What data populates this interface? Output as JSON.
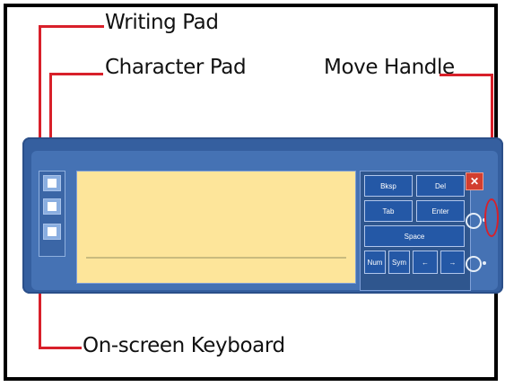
{
  "labels": {
    "writing_pad": "Writing Pad",
    "character_pad": "Character Pad",
    "move_handle": "Move Handle",
    "on_screen_keyboard": "On-screen Keyboard"
  },
  "keys": {
    "bksp": "Bksp",
    "del": "Del",
    "tab": "Tab",
    "enter": "Enter",
    "space": "Space",
    "num": "Num",
    "sym": "Sym",
    "left": "←",
    "right": "→"
  },
  "buttons": {
    "close": "✕"
  },
  "colors": {
    "panel_blue": "#355f9f",
    "writing_area": "#fde59a",
    "callout_red": "#d8202a"
  }
}
